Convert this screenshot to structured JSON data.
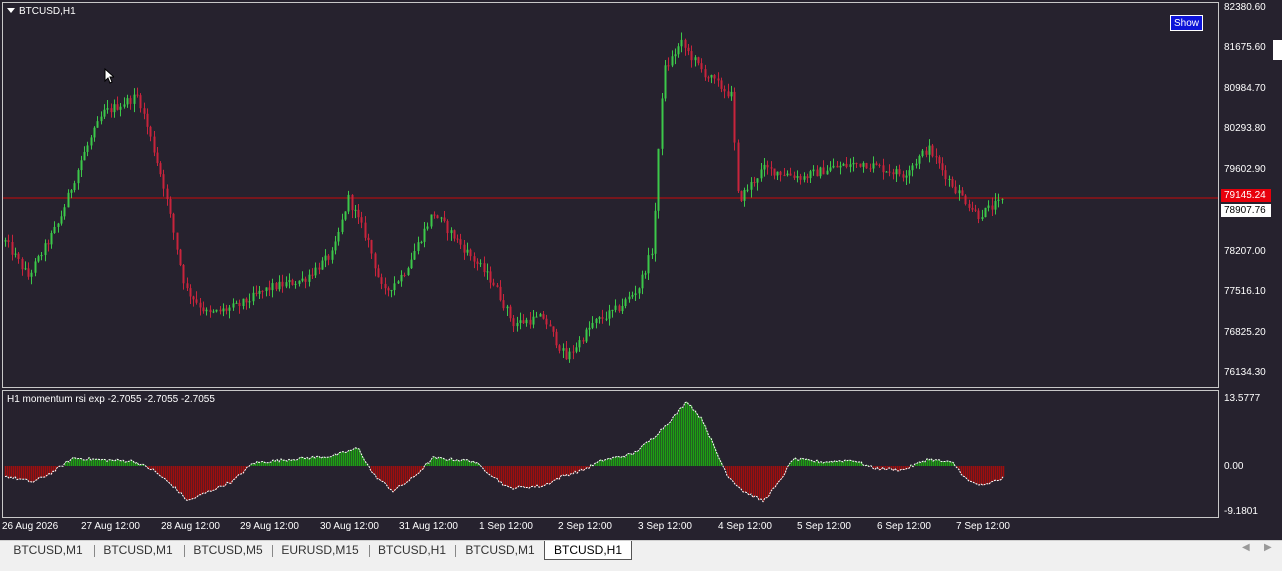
{
  "chart": {
    "symbol_title": "BTCUSD,H1",
    "show_button": "Show",
    "indicator_title": "H1 momentum rsi exp  -2.7055 -2.7055 -2.7055",
    "price_scale": [
      "82380.60",
      "81675.60",
      "80984.70",
      "80293.80",
      "79602.90",
      "78207.00",
      "77516.10",
      "76825.20",
      "76134.30"
    ],
    "bid_price": "79145.24",
    "ask_price": "78907.76",
    "indicator_scale": [
      "13.5777",
      "0.00",
      "-9.1801"
    ],
    "time_labels": [
      "26 Aug 2026",
      "27 Aug 12:00",
      "28 Aug 12:00",
      "29 Aug 12:00",
      "30 Aug 12:00",
      "31 Aug 12:00",
      "1 Sep 12:00",
      "2 Sep 12:00",
      "3 Sep 12:00",
      "4 Sep 12:00",
      "5 Sep 12:00",
      "6 Sep 12:00",
      "7 Sep 12:00"
    ]
  },
  "colors": {
    "background": "#26222e",
    "bull_candle": "#3cc84a",
    "bear_candle": "#c8243c",
    "bid_line": "#c80a0a",
    "hist_positive": "#1e9e14",
    "hist_negative": "#9e0e0e",
    "signal_line": "#ffffff",
    "show_button": "#0d14d8"
  },
  "tabs": [
    {
      "label": "BTCUSD,M1"
    },
    {
      "label": "BTCUSD,M1"
    },
    {
      "label": "BTCUSD,M5"
    },
    {
      "label": "EURUSD,M15"
    },
    {
      "label": "BTCUSD,H1"
    },
    {
      "label": "BTCUSD,M1"
    },
    {
      "label": "BTCUSD,H1",
      "active": true
    }
  ],
  "icons": {
    "tab_scroll_left": "chevron-left-icon",
    "tab_scroll_right": "chevron-right-icon",
    "cursor": "mouse-pointer-icon"
  }
}
